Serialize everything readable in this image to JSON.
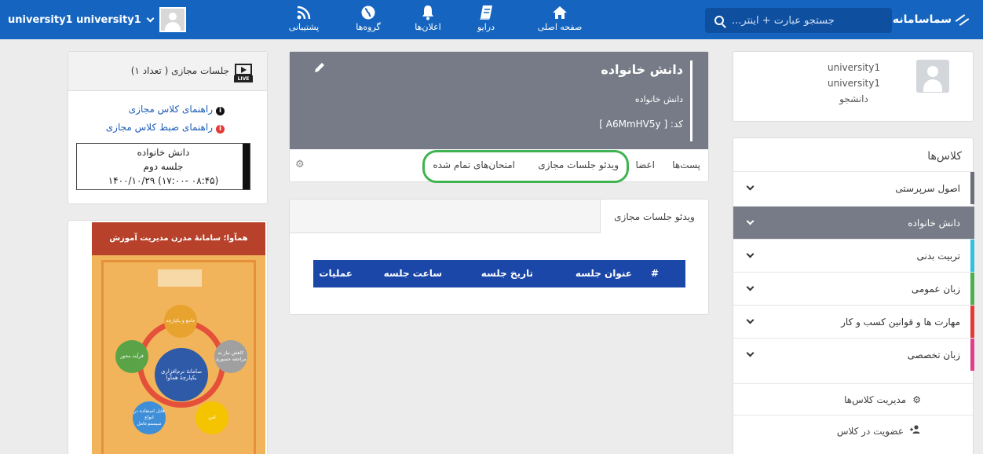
{
  "topbar": {
    "brand": "سماسامانه",
    "search_placeholder": "جستجو عبارت + اینتر...",
    "nav": {
      "home": "صفحه اصلی",
      "drive": "درایو",
      "announcements": "اعلان‌ها",
      "groups": "گروه‌ها",
      "support": "پشتیبانی"
    },
    "user": "university1 university1"
  },
  "profile": {
    "line1": "university1",
    "line2": "university1",
    "role": "دانشجو"
  },
  "classes": {
    "title": "کلاس‌ها",
    "items": [
      {
        "label": "اصول سرپرستی",
        "color": "#6b6f78"
      },
      {
        "label": "دانش خانواده",
        "color": "#767b87"
      },
      {
        "label": "تربیت بدنی",
        "color": "#31c0e0"
      },
      {
        "label": "زبان عمومی",
        "color": "#4caf50"
      },
      {
        "label": "مهارت ها و قوانین کسب و کار",
        "color": "#e53935"
      },
      {
        "label": "زبان تخصصی",
        "color": "#e0408a"
      }
    ],
    "manage": "مدیریت کلاس‌ها",
    "join": "عضویت در کلاس"
  },
  "course": {
    "title": "دانش خانواده",
    "subtitle": "دانش خانواده",
    "code": "کد: [ A6MmHV5y ]",
    "tabs": {
      "posts": "پست‌ها",
      "members": "اعضا",
      "videos": "ویدئو جلسات مجازی",
      "exams": "امتحان‌های تمام شده"
    }
  },
  "video_panel": {
    "tab": "ویدئو جلسات مجازی",
    "columns": [
      "#",
      "عنوان جلسه",
      "تاریخ جلسه",
      "ساعت جلسه",
      "عملیات"
    ]
  },
  "live": {
    "title": "جلسات مجازی ( تعداد ۱)",
    "live_badge": "LIVE",
    "guide1": "راهنمای کلاس مجازی",
    "guide2": "راهنمای ضبط کلاس مجازی",
    "session_course": "دانش خانواده",
    "session_number": "جلسه دوم",
    "session_time": "۱۴۰۰/۱۰/۲۹ (۱۷:۰۰- ۰۸:۴۵)"
  },
  "poster": {
    "headline": "همآوا؛ سامانهٔ مدرن مدیریت آموزش",
    "center": "سامانهٔ نرم‌افزاری یکپارچهٔ همآوا",
    "c1": "جامع و یکپارچه",
    "c2": "کاهش نیاز به مراجعه حضوری",
    "c3": "امن",
    "c4": "قابل استفاده در انواع سیستم‌عامل",
    "c5": "فرآیند محور"
  }
}
